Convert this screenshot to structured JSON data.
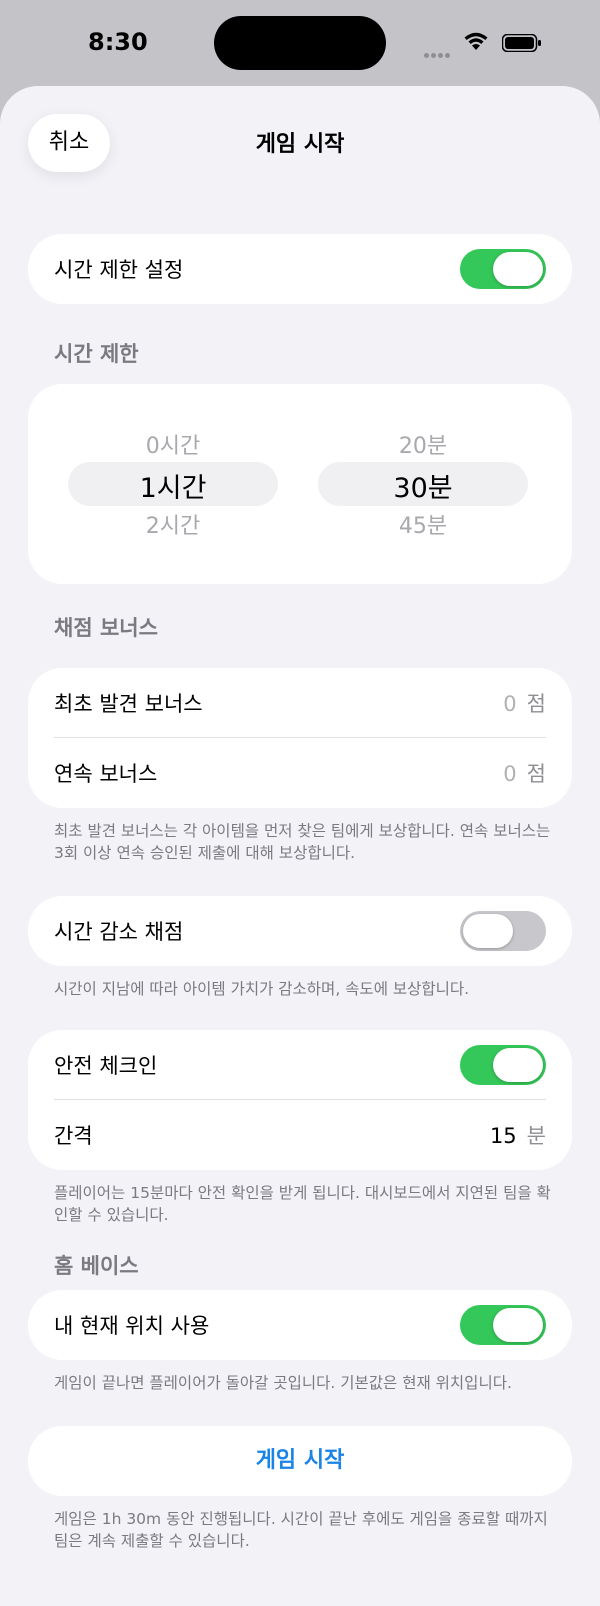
{
  "status_bar": {
    "time": "8:30",
    "icons": [
      "signal-dots-icon",
      "wifi-icon",
      "battery-icon"
    ]
  },
  "header": {
    "cancel_label": "취소",
    "title": "게임 시작"
  },
  "time_limit_setting": {
    "label": "시간 제한 설정",
    "enabled": true
  },
  "time_limit": {
    "header": "시간 제한",
    "hours": {
      "prev": "0시간",
      "selected": "1시간",
      "next": "2시간"
    },
    "minutes": {
      "prev": "20분",
      "selected": "30분",
      "next": "45분"
    }
  },
  "scoring_bonus": {
    "header": "채점 보너스",
    "first_find": {
      "label": "최초 발견 보너스",
      "value": "0",
      "unit": "점"
    },
    "streak": {
      "label": "연속 보너스",
      "value": "0",
      "unit": "점"
    },
    "footnote": "최초 발견 보너스는 각 아이템을 먼저 찾은 팀에게 보상합니다. 연속 보너스는 3회 이상 연속 승인된 제출에 대해 보상합니다."
  },
  "time_decay": {
    "label": "시간 감소 채점",
    "enabled": false,
    "footnote": "시간이 지남에 따라 아이템 가치가 감소하며, 속도에 보상합니다."
  },
  "safety_checkin": {
    "label": "안전 체크인",
    "enabled": true,
    "interval_label": "간격",
    "interval_value": "15",
    "interval_unit": "분",
    "footnote": "플레이어는 15분마다 안전 확인을 받게 됩니다. 대시보드에서 지연된 팀을 확인할 수 있습니다."
  },
  "home_base": {
    "header": "홈 베이스",
    "label": "내 현재 위치 사용",
    "enabled": true,
    "footnote": "게임이 끝나면 플레이어가 돌아갈 곳입니다. 기본값은 현재 위치입니다."
  },
  "start": {
    "button_label": "게임 시작",
    "footnote": "게임은 1h 30m 동안 진행됩니다. 시간이 끝난 후에도 게임을 종료할 때까지 팀은 계속 제출할 수 있습니다."
  },
  "colors": {
    "toggle_on": "#34c759",
    "toggle_off": "#c7c7cc",
    "accent": "#1a84e6",
    "sheet_bg": "#f2f2f7"
  }
}
